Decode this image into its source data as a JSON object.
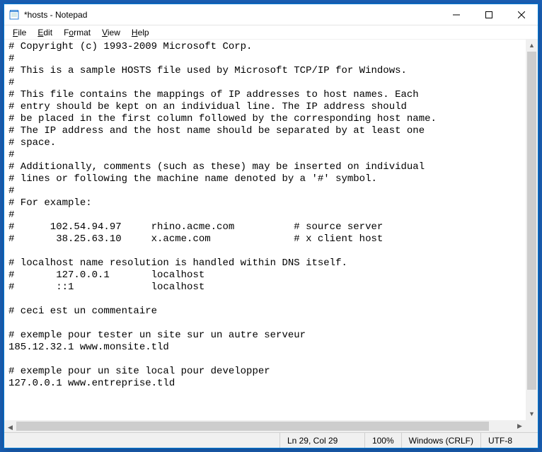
{
  "titlebar": {
    "title": "*hosts - Notepad"
  },
  "menu": {
    "file": "File",
    "edit": "Edit",
    "format": "Format",
    "view": "View",
    "help": "Help"
  },
  "editor": {
    "content": "# Copyright (c) 1993-2009 Microsoft Corp.\n#\n# This is a sample HOSTS file used by Microsoft TCP/IP for Windows.\n#\n# This file contains the mappings of IP addresses to host names. Each\n# entry should be kept on an individual line. The IP address should\n# be placed in the first column followed by the corresponding host name.\n# The IP address and the host name should be separated by at least one\n# space.\n#\n# Additionally, comments (such as these) may be inserted on individual\n# lines or following the machine name denoted by a '#' symbol.\n#\n# For example:\n#\n#      102.54.94.97     rhino.acme.com          # source server\n#       38.25.63.10     x.acme.com              # x client host\n\n# localhost name resolution is handled within DNS itself.\n#\t127.0.0.1       localhost\n#\t::1             localhost\n\n# ceci est un commentaire\n\n# exemple pour tester un site sur un autre serveur\n185.12.32.1 www.monsite.tld\n\n# exemple pour un site local pour developper\n127.0.0.1 www.entreprise.tld"
  },
  "statusbar": {
    "position": "Ln 29, Col 29",
    "zoom": "100%",
    "eol": "Windows (CRLF)",
    "encoding": "UTF-8"
  }
}
